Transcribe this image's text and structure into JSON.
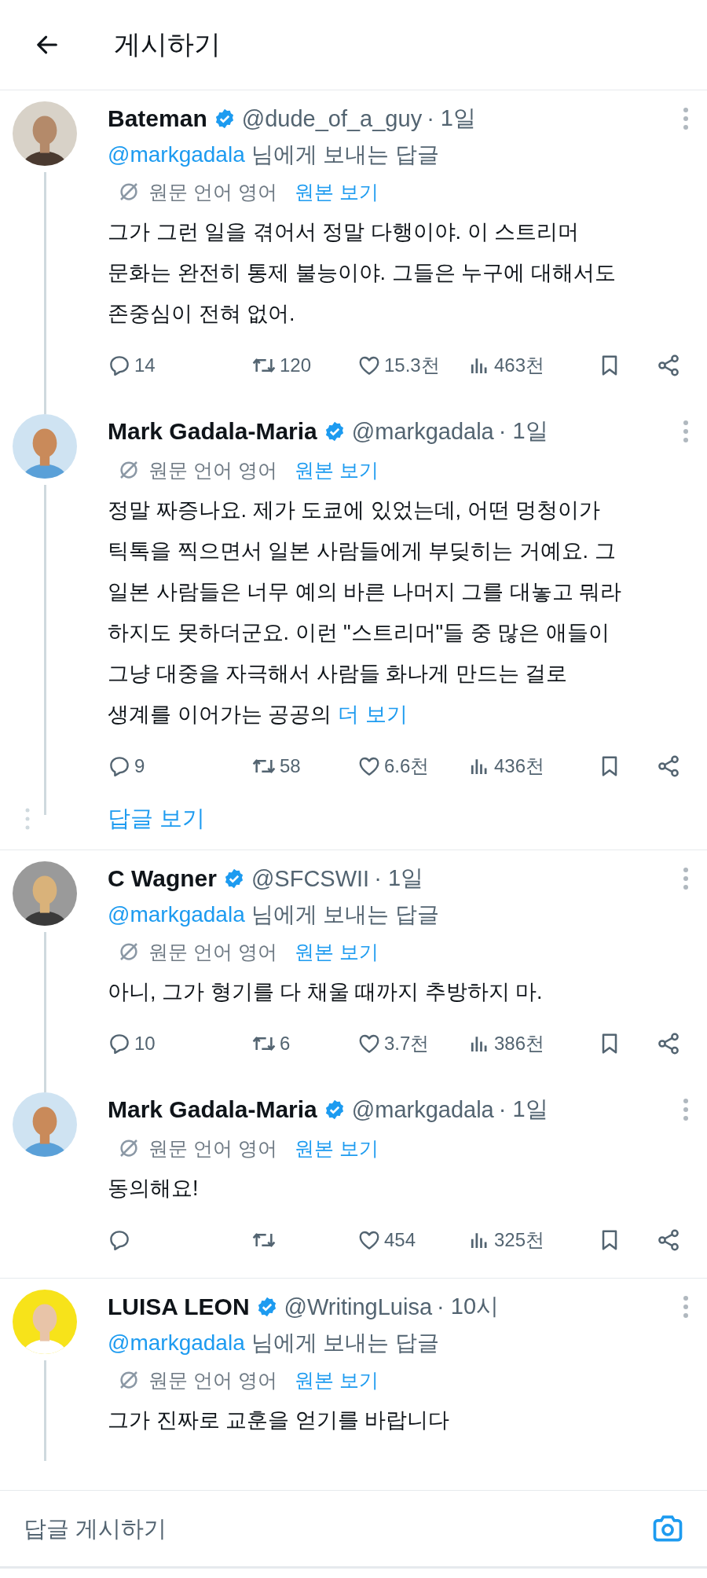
{
  "header": {
    "title": "게시하기"
  },
  "threads": [
    {
      "tweets": [
        {
          "name": "Bateman",
          "verified": true,
          "handle": "@dude_of_a_guy",
          "time": "· 1일",
          "reply_to": {
            "handle": "@markgadala",
            "text": "님에게 보내는 답글"
          },
          "translation": {
            "label": "원문 언어 영어",
            "link": "원본 보기"
          },
          "body": "그가 그런 일을 겪어서 정말 다행이야. 이 스트리머\n문화는 완전히 통제 불능이야. 그들은 누구에 대해서도\n존중심이 전혀 없어.",
          "stats": {
            "replies": "14",
            "reposts": "120",
            "likes": "15.3천",
            "views": "463천"
          },
          "thread_line": true
        },
        {
          "name": "Mark Gadala-Maria",
          "verified": true,
          "handle": "@markgadala",
          "time": "· 1일",
          "translation": {
            "label": "원문 언어 영어",
            "link": "원본 보기"
          },
          "body": "정말 짜증나요. 제가 도쿄에 있었는데, 어떤 멍청이가\n틱톡을 찍으면서 일본 사람들에게 부딪히는 거예요. 그\n일본 사람들은 너무 예의 바른 나머지 그를 대놓고 뭐라\n하지도 못하더군요. 이런 \"스트리머\"들 중 많은 애들이\n그냥 대중을 자극해서 사람들 화나게 만드는 걸로\n생계를 이어가는 공공의",
          "more": "더 보기",
          "stats": {
            "replies": "9",
            "reposts": "58",
            "likes": "6.6천",
            "views": "436천"
          },
          "thread_line": true
        }
      ],
      "show_replies": "답글 보기"
    },
    {
      "tweets": [
        {
          "name": "C Wagner",
          "verified": true,
          "handle": "@SFCSWII",
          "time": "· 1일",
          "reply_to": {
            "handle": "@markgadala",
            "text": "님에게 보내는 답글"
          },
          "translation": {
            "label": "원문 언어 영어",
            "link": "원본 보기"
          },
          "body": "아니, 그가 형기를 다 채울 때까지 추방하지 마.",
          "stats": {
            "replies": "10",
            "reposts": "6",
            "likes": "3.7천",
            "views": "386천"
          },
          "thread_line": true
        },
        {
          "name": "Mark Gadala-Maria",
          "verified": true,
          "handle": "@markgadala",
          "time": "· 1일",
          "translation": {
            "label": "원문 언어 영어",
            "link": "원본 보기"
          },
          "body": "동의해요!",
          "stats": {
            "likes": "454",
            "views": "325천"
          },
          "thread_line": false
        }
      ]
    },
    {
      "tweets": [
        {
          "name": "LUISA LEON",
          "verified": true,
          "handle": "@WritingLuisa",
          "time": "· 10시",
          "reply_to": {
            "handle": "@markgadala",
            "text": "님에게 보내는 답글"
          },
          "translation": {
            "label": "원문 언어 영어",
            "link": "원본 보기"
          },
          "body": "그가 진짜로 교훈을 얻기를 바랍니다",
          "thread_line": true
        }
      ]
    }
  ],
  "reply_bar": {
    "placeholder": "답글 게시하기"
  }
}
